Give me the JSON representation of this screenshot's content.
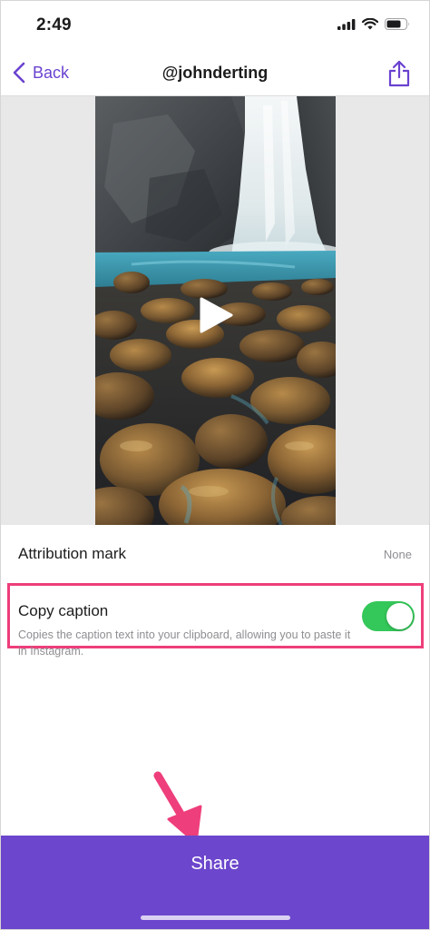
{
  "status_bar": {
    "time": "2:49",
    "icons": [
      "cellular-signal-icon",
      "wifi-icon",
      "battery-icon"
    ]
  },
  "nav": {
    "back_label": "Back",
    "title": "@johnderting",
    "action_icon": "share-icon"
  },
  "media": {
    "type": "video",
    "play_icon": "play-icon"
  },
  "settings": {
    "attribution": {
      "label": "Attribution mark",
      "value": "None"
    },
    "copy_caption": {
      "label": "Copy caption",
      "description": "Copies the caption text into your clipboard, allowing you to paste it in Instagram.",
      "enabled": true
    }
  },
  "footer": {
    "share_label": "Share"
  },
  "colors": {
    "accent": "#6a42d0",
    "share_bar": "#6c46cc",
    "toggle_on": "#34c759",
    "highlight": "#ee3e7b",
    "secondary_text": "#8e8e93"
  }
}
